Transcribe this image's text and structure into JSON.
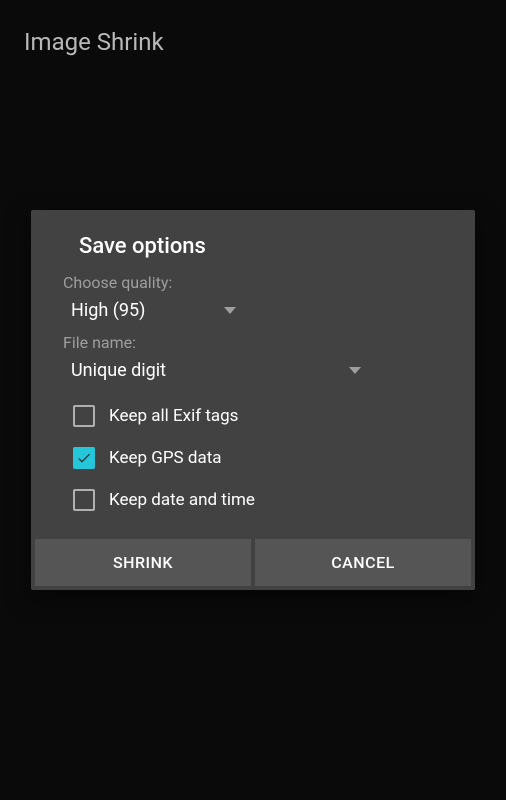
{
  "header": {
    "title": "Image Shrink"
  },
  "dialog": {
    "title": "Save options",
    "quality": {
      "label": "Choose quality:",
      "value": "High (95)"
    },
    "filename": {
      "label": "File name:",
      "value": "Unique digit"
    },
    "checkboxes": [
      {
        "label": "Keep all Exif tags",
        "checked": false
      },
      {
        "label": "Keep GPS data",
        "checked": true
      },
      {
        "label": "Keep date and time",
        "checked": false
      }
    ],
    "buttons": {
      "primary": "SHRINK",
      "secondary": "CANCEL"
    }
  }
}
